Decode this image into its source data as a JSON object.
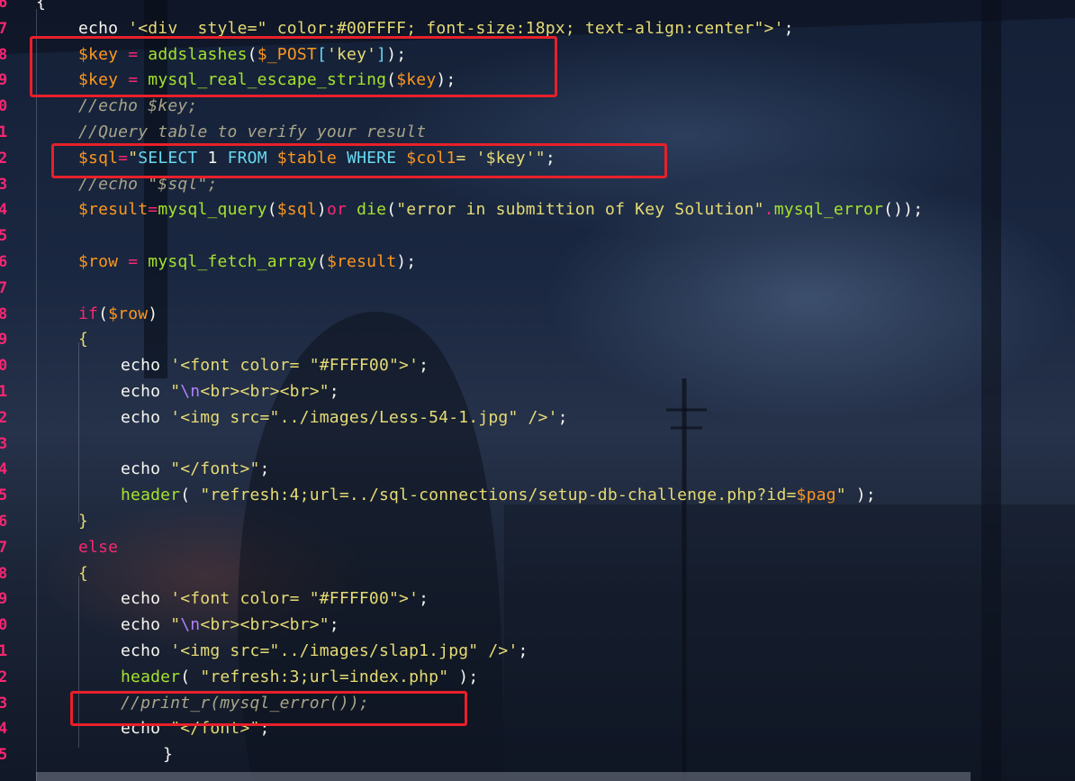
{
  "editor": {
    "lines": [
      {
        "num": "6",
        "indent": 0,
        "tokens": [
          {
            "t": "{",
            "c": "t"
          }
        ]
      },
      {
        "num": "7",
        "indent": 1,
        "tokens": [
          {
            "t": "echo ",
            "c": "t"
          },
          {
            "t": "'<div  style=\" color:#00FFFF; font-size:18px; text-align:center\">'",
            "c": "s"
          },
          {
            "t": ";",
            "c": "p"
          }
        ]
      },
      {
        "num": "8",
        "indent": 1,
        "tokens": [
          {
            "t": "$key",
            "c": "v"
          },
          {
            "t": " = ",
            "c": "k"
          },
          {
            "t": "addslashes",
            "c": "f"
          },
          {
            "t": "(",
            "c": "p"
          },
          {
            "t": "$_POST",
            "c": "v"
          },
          {
            "t": "[",
            "c": "b"
          },
          {
            "t": "'key'",
            "c": "s"
          },
          {
            "t": "]",
            "c": "b"
          },
          {
            "t": ");",
            "c": "p"
          }
        ]
      },
      {
        "num": "9",
        "indent": 1,
        "tokens": [
          {
            "t": "$key",
            "c": "v"
          },
          {
            "t": " = ",
            "c": "k"
          },
          {
            "t": "mysql_real_escape_string",
            "c": "f"
          },
          {
            "t": "(",
            "c": "p"
          },
          {
            "t": "$key",
            "c": "v"
          },
          {
            "t": ");",
            "c": "p"
          }
        ]
      },
      {
        "num": "0",
        "indent": 1,
        "tokens": [
          {
            "t": "//echo $key;",
            "c": "c"
          }
        ]
      },
      {
        "num": "1",
        "indent": 1,
        "tokens": [
          {
            "t": "//Query table to verify your result",
            "c": "c"
          }
        ]
      },
      {
        "num": "2",
        "indent": 1,
        "tokens": [
          {
            "t": "$sql",
            "c": "v"
          },
          {
            "t": "=",
            "c": "k"
          },
          {
            "t": "\"",
            "c": "s"
          },
          {
            "t": "SELECT ",
            "c": "b"
          },
          {
            "t": "1",
            "c": "t"
          },
          {
            "t": " FROM ",
            "c": "b"
          },
          {
            "t": "$table",
            "c": "v"
          },
          {
            "t": " WHERE ",
            "c": "b"
          },
          {
            "t": "$col1",
            "c": "v"
          },
          {
            "t": "= ",
            "c": "s"
          },
          {
            "t": "'$key'",
            "c": "s"
          },
          {
            "t": "\"",
            "c": "s"
          },
          {
            "t": ";",
            "c": "p"
          }
        ]
      },
      {
        "num": "3",
        "indent": 1,
        "tokens": [
          {
            "t": "//echo \"$sql\";",
            "c": "c"
          }
        ]
      },
      {
        "num": "4",
        "indent": 1,
        "tokens": [
          {
            "t": "$result",
            "c": "v"
          },
          {
            "t": "=",
            "c": "k"
          },
          {
            "t": "mysql_query",
            "c": "f"
          },
          {
            "t": "(",
            "c": "p"
          },
          {
            "t": "$sql",
            "c": "v"
          },
          {
            "t": ")",
            "c": "p"
          },
          {
            "t": "or ",
            "c": "k"
          },
          {
            "t": "die",
            "c": "f"
          },
          {
            "t": "(",
            "c": "p"
          },
          {
            "t": "\"error in submittion of Key Solution\"",
            "c": "s"
          },
          {
            "t": ".",
            "c": "k"
          },
          {
            "t": "mysql_error",
            "c": "f"
          },
          {
            "t": "());",
            "c": "p"
          }
        ]
      },
      {
        "num": "5",
        "indent": 0,
        "tokens": []
      },
      {
        "num": "6",
        "indent": 1,
        "tokens": [
          {
            "t": "$row",
            "c": "v"
          },
          {
            "t": " = ",
            "c": "k"
          },
          {
            "t": "mysql_fetch_array",
            "c": "f"
          },
          {
            "t": "(",
            "c": "p"
          },
          {
            "t": "$result",
            "c": "v"
          },
          {
            "t": ");",
            "c": "p"
          }
        ]
      },
      {
        "num": "7",
        "indent": 0,
        "tokens": []
      },
      {
        "num": "8",
        "indent": 1,
        "tokens": [
          {
            "t": "if",
            "c": "k"
          },
          {
            "t": "(",
            "c": "p"
          },
          {
            "t": "$row",
            "c": "v"
          },
          {
            "t": ")",
            "c": "p"
          }
        ]
      },
      {
        "num": "9",
        "indent": 1,
        "tokens": [
          {
            "t": "{",
            "c": "s"
          }
        ]
      },
      {
        "num": "0",
        "indent": 2,
        "tokens": [
          {
            "t": "echo ",
            "c": "t"
          },
          {
            "t": "'<font color= \"#FFFF00\">'",
            "c": "s"
          },
          {
            "t": ";",
            "c": "p"
          }
        ]
      },
      {
        "num": "1",
        "indent": 2,
        "tokens": [
          {
            "t": "echo ",
            "c": "t"
          },
          {
            "t": "\"",
            "c": "s"
          },
          {
            "t": "\\n",
            "c": "n"
          },
          {
            "t": "<br><br><br>\"",
            "c": "s"
          },
          {
            "t": ";",
            "c": "p"
          }
        ]
      },
      {
        "num": "2",
        "indent": 2,
        "tokens": [
          {
            "t": "echo ",
            "c": "t"
          },
          {
            "t": "'<img src=\"../images/Less-54-1.jpg\" />'",
            "c": "s"
          },
          {
            "t": ";",
            "c": "p"
          }
        ]
      },
      {
        "num": "3",
        "indent": 0,
        "tokens": []
      },
      {
        "num": "4",
        "indent": 2,
        "tokens": [
          {
            "t": "echo ",
            "c": "t"
          },
          {
            "t": "\"</font>\"",
            "c": "s"
          },
          {
            "t": ";",
            "c": "p"
          }
        ]
      },
      {
        "num": "5",
        "indent": 2,
        "tokens": [
          {
            "t": "header",
            "c": "f"
          },
          {
            "t": "( ",
            "c": "p"
          },
          {
            "t": "\"refresh:4;url=../sql-connections/setup-db-challenge.php?id=",
            "c": "s"
          },
          {
            "t": "$pag",
            "c": "v"
          },
          {
            "t": "\"",
            "c": "s"
          },
          {
            "t": " );",
            "c": "p"
          }
        ]
      },
      {
        "num": "6",
        "indent": 1,
        "tokens": [
          {
            "t": "}",
            "c": "s"
          }
        ]
      },
      {
        "num": "7",
        "indent": 1,
        "tokens": [
          {
            "t": "else",
            "c": "k"
          }
        ]
      },
      {
        "num": "8",
        "indent": 1,
        "tokens": [
          {
            "t": "{",
            "c": "s"
          }
        ]
      },
      {
        "num": "9",
        "indent": 2,
        "tokens": [
          {
            "t": "echo ",
            "c": "t"
          },
          {
            "t": "'<font color= \"#FFFF00\">'",
            "c": "s"
          },
          {
            "t": ";",
            "c": "p"
          }
        ]
      },
      {
        "num": "0",
        "indent": 2,
        "tokens": [
          {
            "t": "echo ",
            "c": "t"
          },
          {
            "t": "\"",
            "c": "s"
          },
          {
            "t": "\\n",
            "c": "n"
          },
          {
            "t": "<br><br><br>\"",
            "c": "s"
          },
          {
            "t": ";",
            "c": "p"
          }
        ]
      },
      {
        "num": "1",
        "indent": 2,
        "tokens": [
          {
            "t": "echo ",
            "c": "t"
          },
          {
            "t": "'<img src=\"../images/slap1.jpg\" />'",
            "c": "s"
          },
          {
            "t": ";",
            "c": "p"
          }
        ]
      },
      {
        "num": "2",
        "indent": 2,
        "tokens": [
          {
            "t": "header",
            "c": "f"
          },
          {
            "t": "( ",
            "c": "p"
          },
          {
            "t": "\"refresh:3;url=index.php\"",
            "c": "s"
          },
          {
            "t": " );",
            "c": "p"
          }
        ]
      },
      {
        "num": "3",
        "indent": 2,
        "tokens": [
          {
            "t": "//print_r(mysql_error());",
            "c": "c"
          }
        ]
      },
      {
        "num": "4",
        "indent": 2,
        "tokens": [
          {
            "t": "echo ",
            "c": "t"
          },
          {
            "t": "\"</font>\"",
            "c": "s"
          },
          {
            "t": ";",
            "c": "p"
          }
        ]
      },
      {
        "num": "5",
        "indent": 3,
        "tokens": [
          {
            "t": "}",
            "c": "t"
          }
        ]
      }
    ]
  },
  "colors": {
    "keyword": "#f92672",
    "string": "#e6db74",
    "variable": "#fd971f",
    "function": "#a6e22e",
    "comment": "#a8a48a",
    "sql_keyword": "#66d9ef",
    "highlight_box": "#e8202a"
  }
}
